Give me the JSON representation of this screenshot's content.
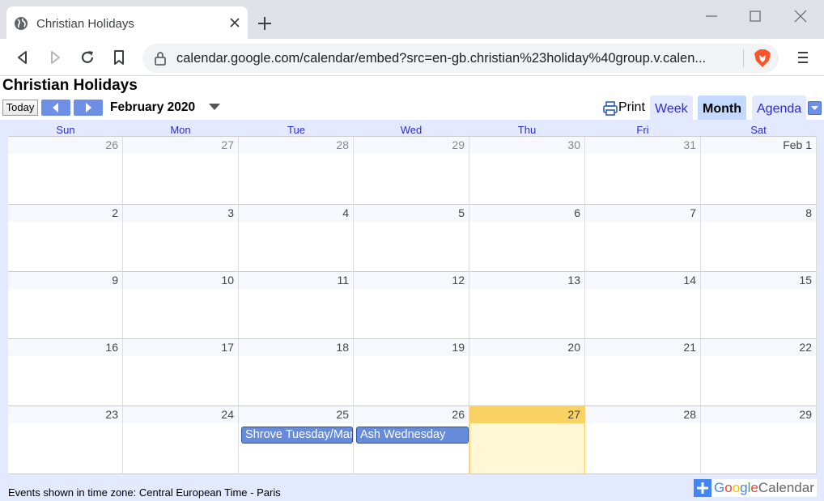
{
  "browser": {
    "tab_title": "Christian Holidays",
    "url": "calendar.google.com/calendar/embed?src=en-gb.christian%23holiday%40group.v.calen..."
  },
  "calendar": {
    "title": "Christian Holidays",
    "today_label": "Today",
    "current_period": "February 2020",
    "print_label": "Print",
    "views": [
      "Week",
      "Month",
      "Agenda"
    ],
    "active_view": "Month",
    "day_headers": [
      "Sun",
      "Mon",
      "Tue",
      "Wed",
      "Thu",
      "Fri",
      "Sat"
    ],
    "weeks": [
      [
        "26",
        "27",
        "28",
        "29",
        "30",
        "31",
        "Feb 1"
      ],
      [
        "2",
        "3",
        "4",
        "5",
        "6",
        "7",
        "8"
      ],
      [
        "9",
        "10",
        "11",
        "12",
        "13",
        "14",
        "15"
      ],
      [
        "16",
        "17",
        "18",
        "19",
        "20",
        "21",
        "22"
      ],
      [
        "23",
        "24",
        "25",
        "26",
        "27",
        "28",
        "29"
      ]
    ],
    "today": "27",
    "events": [
      {
        "title": "Shrove Tuesday/Mardi Gras",
        "date": "25"
      },
      {
        "title": "Ash Wednesday",
        "date": "26"
      }
    ],
    "timezone_note": "Events shown in time zone: Central European Time - Paris",
    "footer_logo": {
      "google": "Google",
      "calendar": "Calendar"
    },
    "colors": {
      "header_bg": "#e3e9ff",
      "accent": "#2c2ad6",
      "event_bg": "#668cd9",
      "today_bg": "#fff7d6",
      "today_strip": "#fad163"
    }
  }
}
